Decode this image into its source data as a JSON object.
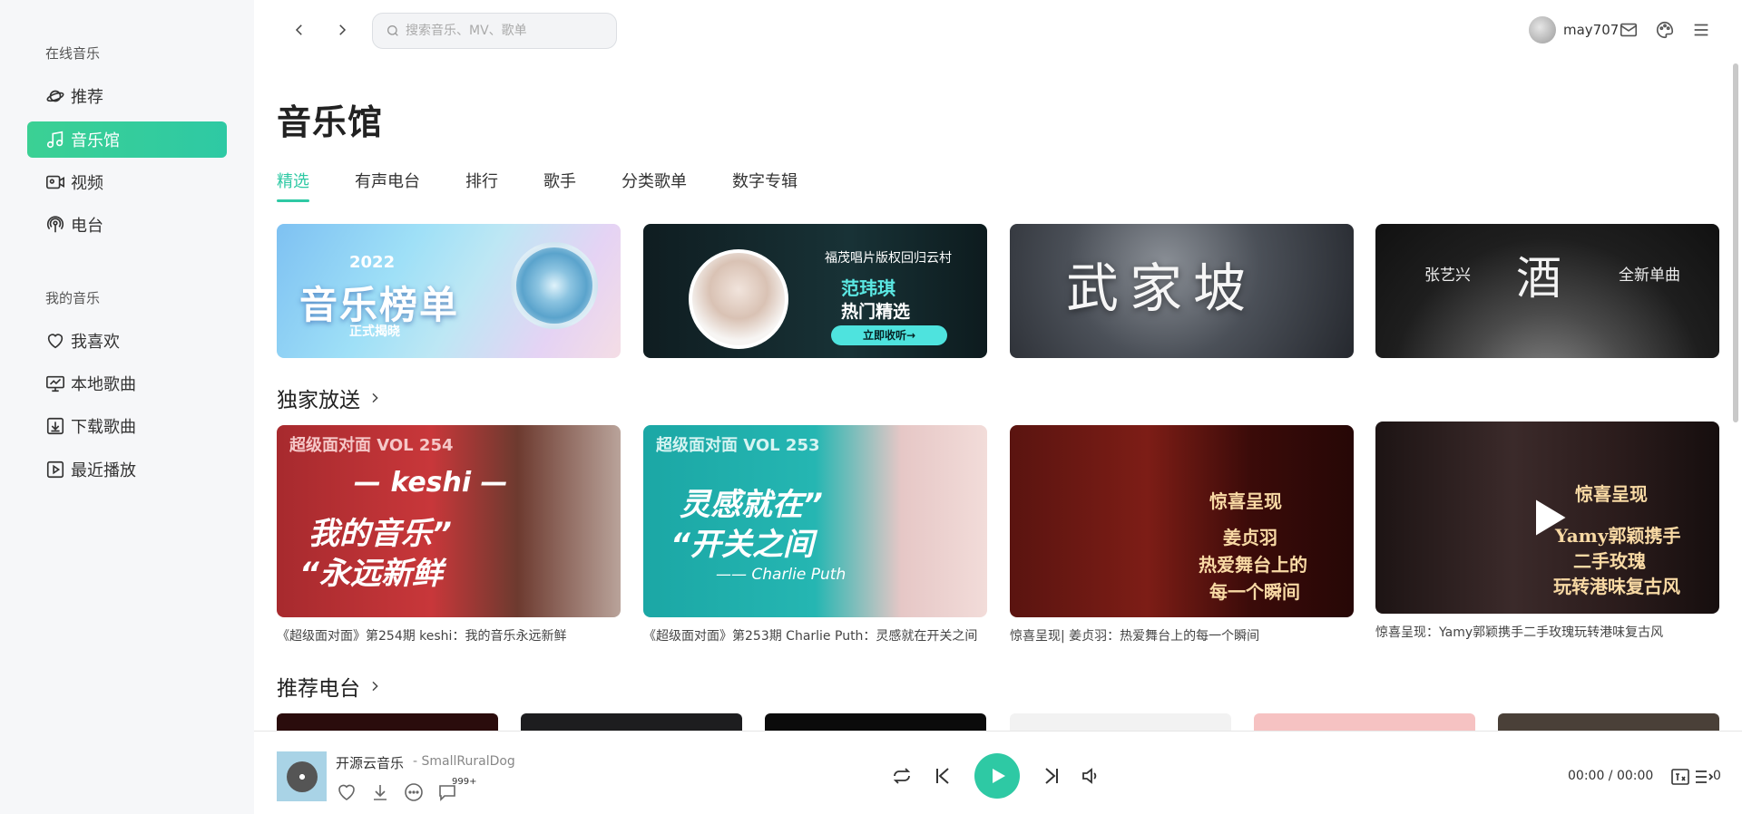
{
  "sidebar": {
    "online_heading": "在线音乐",
    "online_items": [
      {
        "label": "推荐",
        "icon": "planet-icon"
      },
      {
        "label": "音乐馆",
        "icon": "music-note-icon"
      },
      {
        "label": "视频",
        "icon": "video-icon"
      },
      {
        "label": "电台",
        "icon": "radio-icon"
      }
    ],
    "my_heading": "我的音乐",
    "my_items": [
      {
        "label": "我喜欢",
        "icon": "heart-icon"
      },
      {
        "label": "本地歌曲",
        "icon": "monitor-icon"
      },
      {
        "label": "下载歌曲",
        "icon": "download-icon"
      },
      {
        "label": "最近播放",
        "icon": "play-square-icon"
      }
    ],
    "accent": "#2ec9a4"
  },
  "topbar": {
    "search_placeholder": "搜索音乐、MV、歌单",
    "username": "may707"
  },
  "main": {
    "title": "音乐馆",
    "tabs": [
      "精选",
      "有声电台",
      "排行",
      "歌手",
      "分类歌单",
      "数字专辑"
    ],
    "banners": [
      {
        "year": "2022",
        "title": "音乐榜单",
        "subtitle": "正式揭晓"
      },
      {
        "line1": "福茂唱片版权回归云村",
        "name": "范玮琪",
        "line2": "热门精选",
        "button": "立即收听→"
      },
      {
        "title": "武家坡"
      },
      {
        "left": "张艺兴",
        "center": "酒",
        "right": "全新单曲"
      }
    ],
    "exclusive_title": "独家放送",
    "exclusive": [
      {
        "vol": "超级面对面 VOL 254",
        "text1": "— keshi —",
        "text2": "我的音乐”",
        "text3": "“永远新鲜",
        "caption": "《超级面对面》第254期 keshi：我的音乐永远新鲜"
      },
      {
        "vol": "超级面对面 VOL 253",
        "text1": "灵感就在”",
        "text2": "“开关之间",
        "text3": "—— Charlie Puth",
        "caption": "《超级面对面》第253期 Charlie Puth：灵感就在开关之间"
      },
      {
        "text1": "惊喜呈现",
        "text2": "姜贞羽",
        "text3": "热爱舞台上的",
        "text4": "每一个瞬间",
        "caption": "惊喜呈现| 姜贞羽：热爱舞台上的每一个瞬间"
      },
      {
        "text1": "惊喜呈现",
        "text2": "Yamy郭颖携手",
        "text3": "二手玫瑰",
        "text4": "玩转港味复古风",
        "caption": "惊喜呈现：Yamy郭颖携手二手玫瑰玩转港味复古风"
      }
    ],
    "radio_title": "推荐电台"
  },
  "player": {
    "song_title": "开源云音乐",
    "artist": "- SmallRuralDog",
    "comment_count": "999+",
    "time": "00:00 / 00:00",
    "queue_count": "0"
  }
}
